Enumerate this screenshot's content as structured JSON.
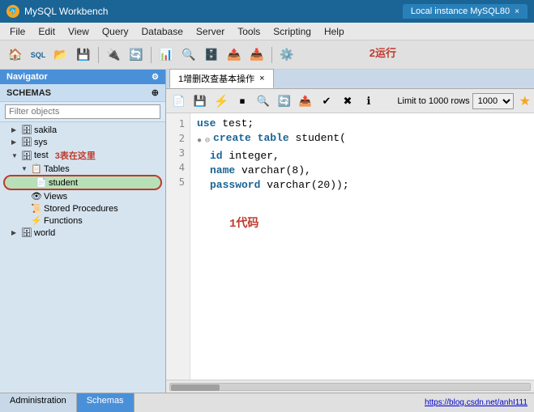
{
  "titlebar": {
    "title": "MySQL Workbench",
    "tab": "Local instance MySQL80",
    "close": "×"
  },
  "menubar": {
    "items": [
      "File",
      "Edit",
      "View",
      "Query",
      "Database",
      "Server",
      "Tools",
      "Scripting",
      "Help"
    ]
  },
  "navigator": {
    "header": "Navigator",
    "schemas_label": "SCHEMAS",
    "filter_placeholder": "Filter objects",
    "tree": [
      {
        "label": "sakila",
        "level": 1,
        "type": "schema",
        "expanded": false
      },
      {
        "label": "sys",
        "level": 1,
        "type": "schema",
        "expanded": false
      },
      {
        "label": "test",
        "level": 1,
        "type": "schema",
        "expanded": true,
        "annotation": "3表在这里"
      },
      {
        "label": "Tables",
        "level": 2,
        "type": "tables",
        "expanded": true
      },
      {
        "label": "student",
        "level": 3,
        "type": "table",
        "highlighted": true
      },
      {
        "label": "Views",
        "level": 3,
        "type": "views"
      },
      {
        "label": "Stored Procedures",
        "level": 3,
        "type": "procedures"
      },
      {
        "label": "Functions",
        "level": 3,
        "type": "functions"
      },
      {
        "label": "world",
        "level": 1,
        "type": "schema",
        "expanded": false
      }
    ]
  },
  "editor": {
    "tab_label": "1增删改查基本操作",
    "tab_close": "×",
    "limit_label": "Limit to 1000 rows",
    "run_annotation": "2运行",
    "code_annotation": "1代码",
    "lines": [
      {
        "num": 1,
        "bullet": "",
        "code": "use test;"
      },
      {
        "num": 2,
        "bullet": "●",
        "bullet_type": "dot",
        "code": "create table student("
      },
      {
        "num": 3,
        "bullet": "",
        "code": "    id integer,"
      },
      {
        "num": 4,
        "bullet": "",
        "code": "    name varchar(8),"
      },
      {
        "num": 5,
        "bullet": "",
        "code": "    password varchar(20));"
      }
    ]
  },
  "statusbar": {
    "admin_label": "Administration",
    "schemas_label": "Schemas",
    "url": "https://blog.csdn.net/anhI111"
  }
}
